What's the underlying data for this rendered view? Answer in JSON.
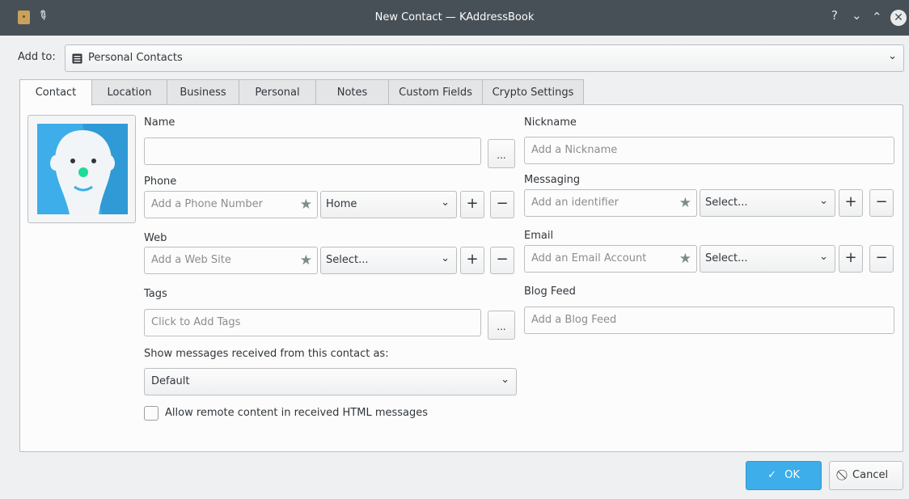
{
  "window": {
    "title": "New Contact — KAddressBook",
    "help_glyph": "?",
    "minimize_glyph": "⌄",
    "maximize_glyph": "⌃",
    "close_glyph": "✕"
  },
  "add_to": {
    "label": "Add to:",
    "value": "Personal Contacts"
  },
  "tabs": [
    {
      "label": "Contact",
      "active": true
    },
    {
      "label": "Location",
      "active": false
    },
    {
      "label": "Business",
      "active": false
    },
    {
      "label": "Personal",
      "active": false
    },
    {
      "label": "Notes",
      "active": false
    },
    {
      "label": "Custom Fields",
      "active": false
    },
    {
      "label": "Crypto Settings",
      "active": false
    }
  ],
  "contact": {
    "name": {
      "label": "Name",
      "value": "",
      "more_button": "..."
    },
    "phone": {
      "label": "Phone",
      "placeholder": "Add a Phone Number",
      "type": "Home"
    },
    "web": {
      "label": "Web",
      "placeholder": "Add a Web Site",
      "type": "Select..."
    },
    "tags": {
      "label": "Tags",
      "placeholder": "Click to Add Tags",
      "more_button": "..."
    },
    "show_messages": {
      "label": "Show messages received from this contact as:",
      "value": "Default"
    },
    "allow_remote": {
      "label": "Allow remote content in received HTML messages",
      "checked": false
    },
    "nickname": {
      "label": "Nickname",
      "placeholder": "Add a Nickname"
    },
    "messaging": {
      "label": "Messaging",
      "placeholder": "Add an identifier",
      "type": "Select..."
    },
    "email": {
      "label": "Email",
      "placeholder": "Add an Email Account",
      "type": "Select..."
    },
    "blog": {
      "label": "Blog Feed",
      "placeholder": "Add a Blog Feed"
    }
  },
  "row_buttons": {
    "add": "+",
    "remove": "−"
  },
  "footer": {
    "ok": "OK",
    "cancel": "Cancel"
  },
  "colors": {
    "accent": "#3daee9",
    "titlebar": "#475057"
  }
}
